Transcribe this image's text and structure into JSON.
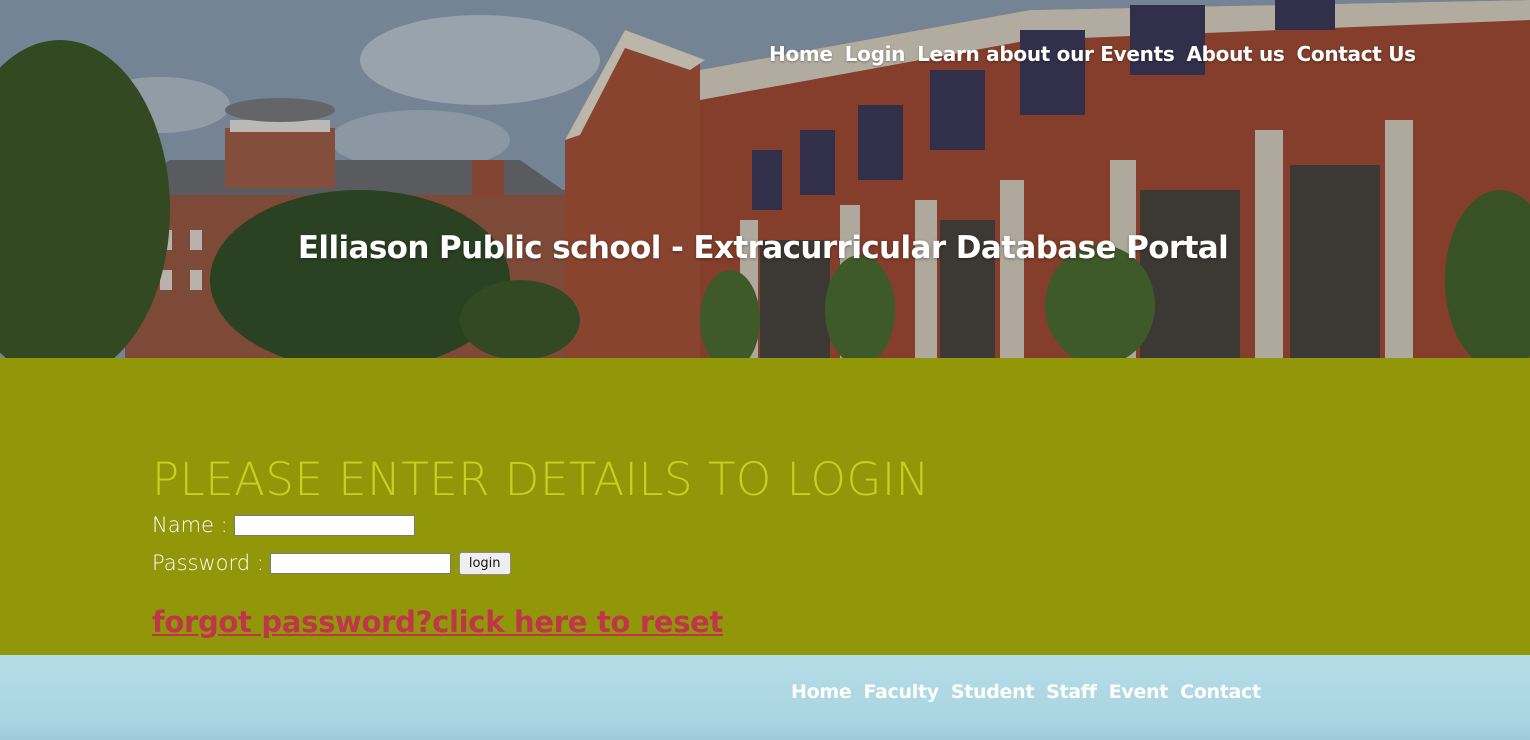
{
  "header": {
    "nav": [
      "Home",
      "Login",
      "Learn about our Events",
      "About us",
      "Contact Us"
    ],
    "title": "Elliason Public school - Extracurricular Database Portal"
  },
  "login": {
    "heading": "PLEASE ENTER DETAILS TO LOGIN",
    "name_label": "Name :",
    "name_value": "",
    "password_label": "Password :",
    "password_value": "",
    "submit_label": "login",
    "reset_link": "forgot password?click here to reset"
  },
  "footer": {
    "nav": [
      "Home",
      "Faculty",
      "Student",
      "Staff",
      "Event",
      "Contact"
    ]
  },
  "colors": {
    "panel_bg": "#919708",
    "heading": "#c9d01e",
    "reset_link": "#c0354a",
    "footer_bg": "#b5dde8"
  }
}
